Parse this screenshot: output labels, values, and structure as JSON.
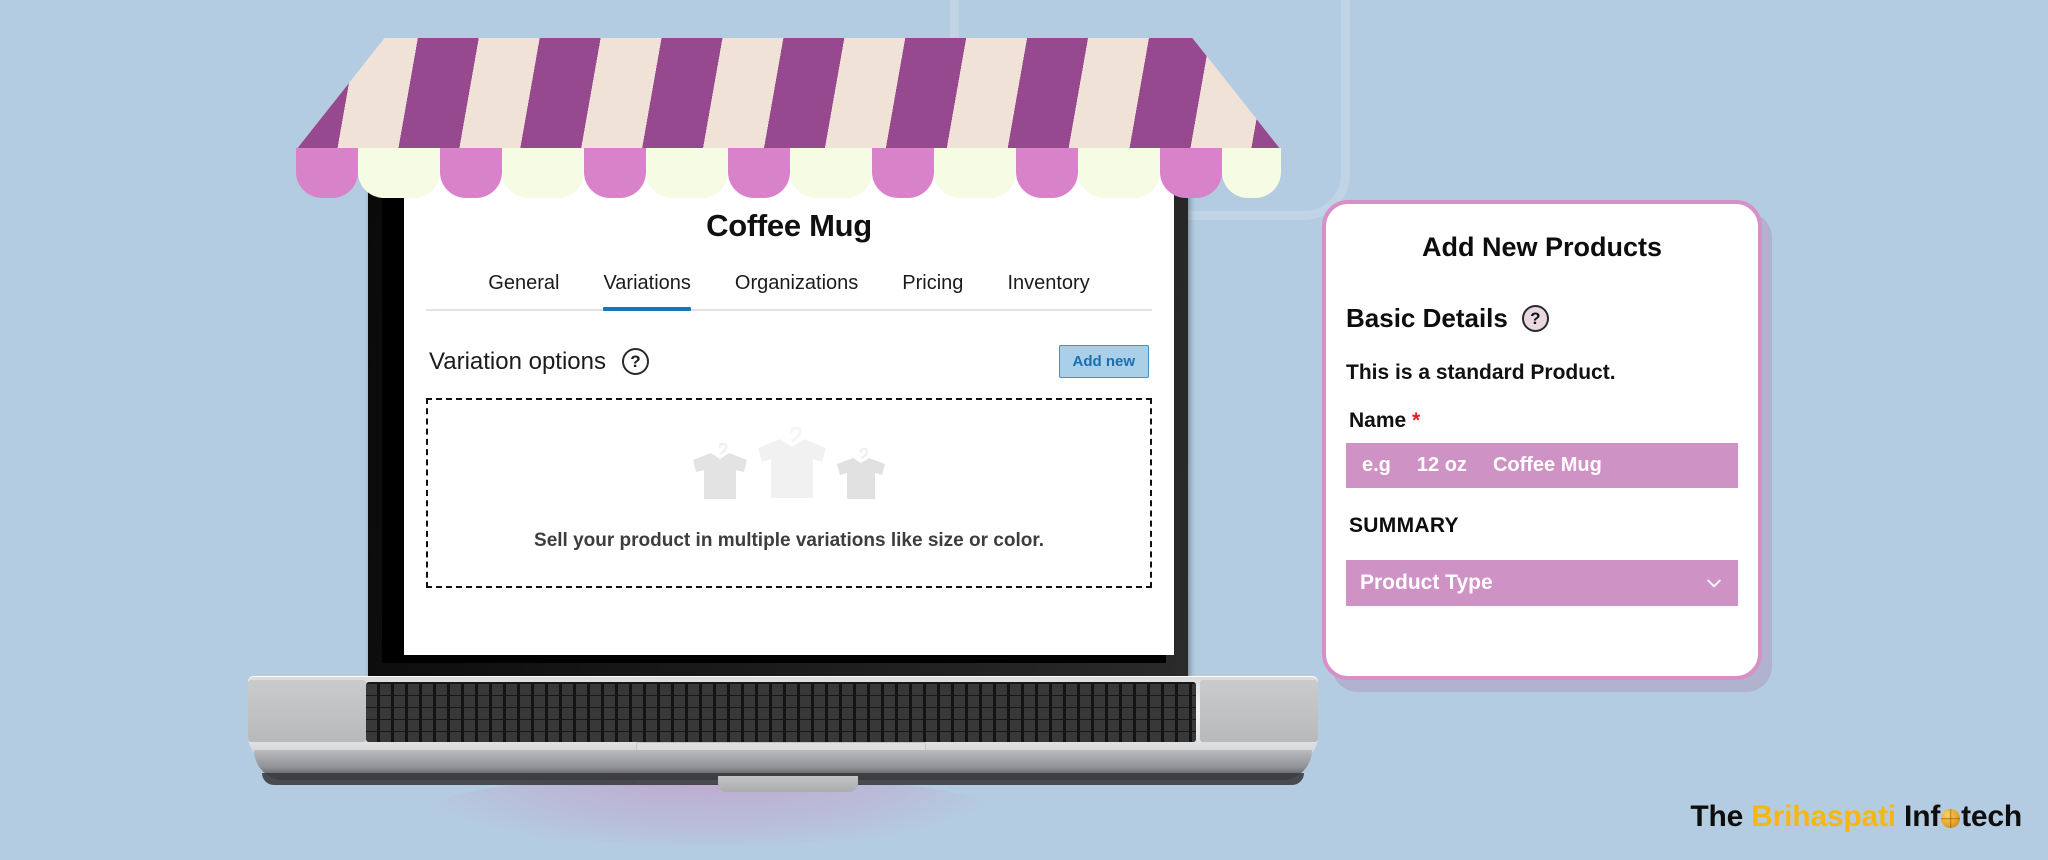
{
  "theme": {
    "background": "#b4cce2",
    "awning_stripe_dark": "#96498e",
    "awning_stripe_light": "#f0e2d6",
    "awning_tab_pink": "#d782c9",
    "awning_tab_cream": "#f6fbe4",
    "accent_blue": "#1877b5",
    "card_border_pink": "#d790c5",
    "input_pink": "#cf92c4",
    "required_red": "#e01b24",
    "logo_accent": "#f5b716"
  },
  "screen": {
    "title": "Coffee Mug",
    "tabs": [
      {
        "label": "General",
        "active": false
      },
      {
        "label": "Variations",
        "active": true
      },
      {
        "label": "Organizations",
        "active": false
      },
      {
        "label": "Pricing",
        "active": false
      },
      {
        "label": "Inventory",
        "active": false
      }
    ],
    "section": {
      "title": "Variation options",
      "help_icon": "question-mark-icon",
      "help_glyph": "?",
      "add_button_label": "Add new"
    },
    "dropzone": {
      "message": "Sell your product in multiple variations like size or color.",
      "illustration": "tshirt-on-hanger-icon"
    }
  },
  "card": {
    "title": "Add New Products",
    "section_title": "Basic Details",
    "section_help_icon": "question-mark-icon",
    "section_help_glyph": "?",
    "subtitle": "This is a standard Product.",
    "name_label": "Name",
    "name_required_marker": "*",
    "name_input": {
      "prefix": "e.g",
      "example_size": "12 oz",
      "example_value": "Coffee Mug"
    },
    "summary_label": "SUMMARY",
    "product_type_select": {
      "value": "Product Type",
      "chevron_icon": "chevron-down-icon"
    }
  },
  "logo": {
    "word1": "The ",
    "word2": "Brihaspati",
    "word3_a": " Inf",
    "globe_icon": "globe-icon",
    "word3_b": "tech"
  }
}
